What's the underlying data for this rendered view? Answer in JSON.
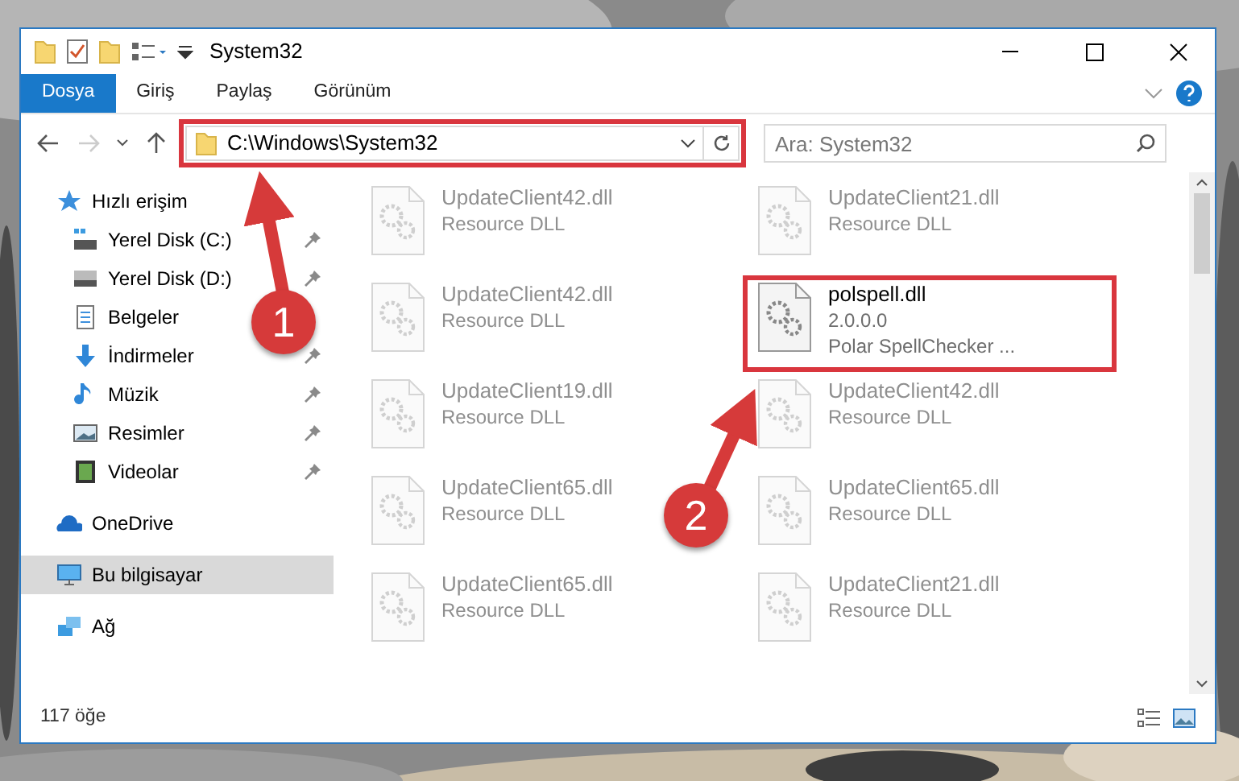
{
  "window": {
    "title": "System32"
  },
  "ribbon": {
    "tabs": [
      {
        "label": "Dosya",
        "selected": true
      },
      {
        "label": "Giriş",
        "selected": false
      },
      {
        "label": "Paylaş",
        "selected": false
      },
      {
        "label": "Görünüm",
        "selected": false
      }
    ]
  },
  "address_bar": {
    "path": "C:\\Windows\\System32",
    "highlighted": true
  },
  "search": {
    "placeholder": "Ara: System32"
  },
  "sidebar": {
    "items": [
      {
        "label": "Hızlı erişim",
        "selected": false,
        "children": [
          {
            "label": "Yerel Disk (C:)",
            "selected": false,
            "pinned": true
          },
          {
            "label": "Yerel Disk (D:)",
            "selected": false,
            "pinned": true
          },
          {
            "label": "Belgeler",
            "selected": false,
            "pinned": false
          },
          {
            "label": "İndirmeler",
            "selected": false,
            "pinned": true
          },
          {
            "label": "Müzik",
            "selected": false,
            "pinned": true
          },
          {
            "label": "Resimler",
            "selected": false,
            "pinned": true
          },
          {
            "label": "Videolar",
            "selected": false,
            "pinned": true
          }
        ]
      },
      {
        "label": "OneDrive",
        "selected": false
      },
      {
        "label": "Bu bilgisayar",
        "selected": true
      },
      {
        "label": "Ağ",
        "selected": false
      }
    ]
  },
  "files": [
    {
      "name": "UpdateClient42.dll",
      "lines": [
        "Resource DLL"
      ],
      "faded": true,
      "highlighted": false
    },
    {
      "name": "UpdateClient21.dll",
      "lines": [
        "Resource DLL"
      ],
      "faded": true,
      "highlighted": false
    },
    {
      "name": "UpdateClient42.dll",
      "lines": [
        "Resource DLL"
      ],
      "faded": true,
      "highlighted": false
    },
    {
      "name": "polspell.dll",
      "lines": [
        "2.0.0.0",
        "Polar SpellChecker ..."
      ],
      "faded": false,
      "highlighted": true
    },
    {
      "name": "UpdateClient19.dll",
      "lines": [
        "Resource DLL"
      ],
      "faded": true,
      "highlighted": false
    },
    {
      "name": "UpdateClient42.dll",
      "lines": [
        "Resource DLL"
      ],
      "faded": true,
      "highlighted": false
    },
    {
      "name": "UpdateClient65.dll",
      "lines": [
        "Resource DLL"
      ],
      "faded": true,
      "highlighted": false
    },
    {
      "name": "UpdateClient65.dll",
      "lines": [
        "Resource DLL"
      ],
      "faded": true,
      "highlighted": false
    },
    {
      "name": "UpdateClient65.dll",
      "lines": [
        "Resource DLL"
      ],
      "faded": true,
      "highlighted": false
    },
    {
      "name": "UpdateClient21.dll",
      "lines": [
        "Resource DLL"
      ],
      "faded": true,
      "highlighted": false
    }
  ],
  "status_bar": {
    "item_count": "117 öğe"
  },
  "annotations": [
    {
      "number": "1"
    },
    {
      "number": "2"
    }
  ]
}
